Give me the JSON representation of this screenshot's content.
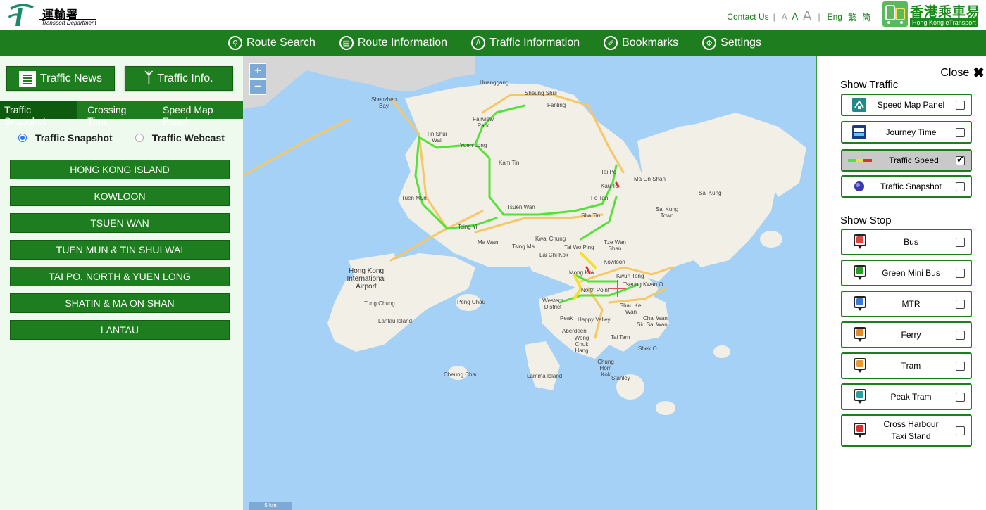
{
  "header": {
    "td_logo_zh": "運輸署",
    "td_logo_en": "Transport Department",
    "contact": "Contact Us",
    "sep": "|",
    "font_sizes": [
      "A",
      "A",
      "A"
    ],
    "languages": [
      "Eng",
      "繁",
      "简"
    ],
    "et_zh": "香港乘車易",
    "et_en": "Hong Kong eTransport"
  },
  "nav": [
    {
      "label": "Route Search",
      "icon": "search-icon"
    },
    {
      "label": "Route Information",
      "icon": "bus-icon"
    },
    {
      "label": "Traffic Information",
      "icon": "road-icon"
    },
    {
      "label": "Bookmarks",
      "icon": "bookmark-icon"
    },
    {
      "label": "Settings",
      "icon": "gear-icon"
    }
  ],
  "left": {
    "buttons": {
      "news": "Traffic News",
      "info": "Traffic Info."
    },
    "tabs": [
      "Traffic Snapshot",
      "Crossing Time",
      "Speed Map Panel"
    ],
    "radios": {
      "snapshot": "Traffic Snapshot",
      "webcast": "Traffic Webcast"
    },
    "regions": [
      "HONG KONG ISLAND",
      "KOWLOON",
      "TSUEN WAN",
      "TUEN MUN & TIN SHUI WAI",
      "TAI PO, NORTH & YUEN LONG",
      "SHATIN & MA ON SHAN",
      "LANTAU"
    ]
  },
  "map": {
    "zoom_in": "+",
    "zoom_out": "−",
    "scale": "5 km",
    "places": [
      "Huanggang",
      "Sheung Shui",
      "Fanling",
      "Shenzhen Bay",
      "Tin Shui Wai",
      "Fairview Park",
      "Yuen Long",
      "Kam Tin",
      "Ma On Shan",
      "Sai Kung",
      "Tai Po",
      "Kau To",
      "Tuen Mun",
      "Tsuen Wan",
      "Fo Tan",
      "Sha Tin",
      "Sai Kung Town",
      "Tsing Yi",
      "Kwai Chung",
      "Tai Wo Ping",
      "Ma Wan",
      "Tsing Ma",
      "Lai Chi Kok",
      "Tze Wan Shan",
      "Kowloon",
      "Kwun Tong",
      "Hong Kong International Airport",
      "Western District",
      "North Point",
      "Tseung Kwan O",
      "Peng Chau",
      "Tung Chung",
      "Lantau Island",
      "Peak",
      "Happy Valley",
      "Shau Kei Wan",
      "Aberdeen",
      "Wong Chuk Hang",
      "Tai Tam",
      "Chai Wan",
      "Siu Sai Wan",
      "Shek O",
      "Cheung Chau",
      "Lamma Island",
      "Chung Hom Kok",
      "Stanley",
      "Mong Kok"
    ]
  },
  "right": {
    "close": "Close",
    "close_icon": "✖",
    "show_traffic": "Show Traffic",
    "traffic_options": [
      {
        "label": "Speed Map Panel",
        "checked": false
      },
      {
        "label": "Journey Time",
        "checked": false
      },
      {
        "label": "Traffic Speed",
        "checked": true
      },
      {
        "label": "Traffic Snapshot",
        "checked": false
      }
    ],
    "show_stop": "Show Stop",
    "stop_options": [
      {
        "label": "Bus",
        "color": "#e04040"
      },
      {
        "label": "Green Mini Bus",
        "color": "#2a9a2a"
      },
      {
        "label": "MTR",
        "color": "#3a7ad8"
      },
      {
        "label": "Ferry",
        "color": "#e08a2a"
      },
      {
        "label": "Tram",
        "color": "#e89a30"
      },
      {
        "label": "Peak Tram",
        "color": "#2aa0a0"
      },
      {
        "label": "Cross Harbour Taxi Stand",
        "color": "#d83030"
      }
    ]
  },
  "colors": {
    "primary": "#1e7d1e",
    "sea": "#a6d1f7",
    "land": "#f2efe6",
    "road": "#f6c766",
    "speed_green": "#56e03a"
  }
}
